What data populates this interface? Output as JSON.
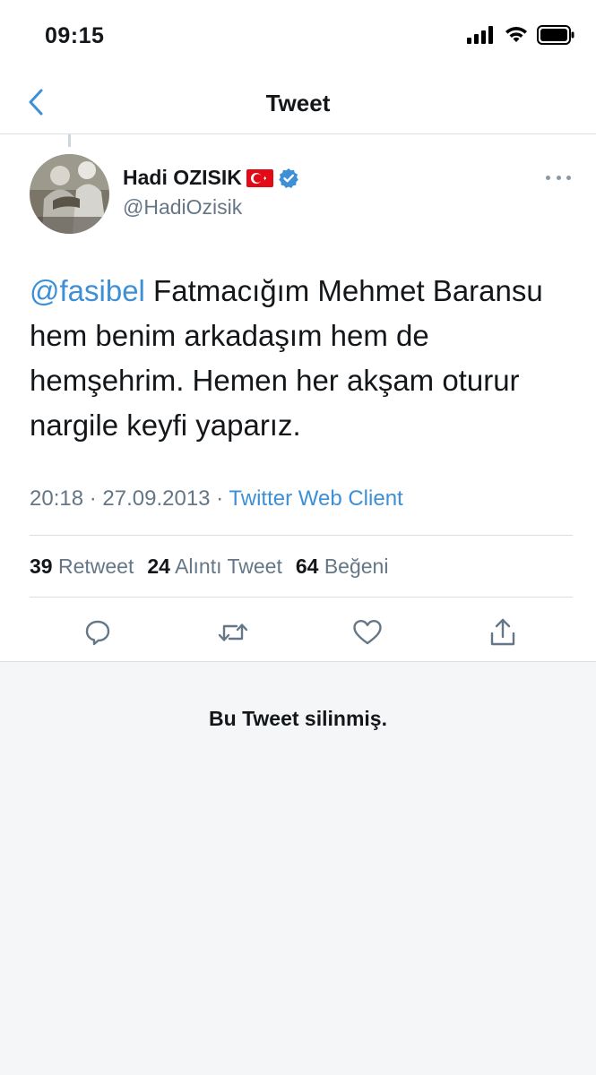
{
  "status_bar": {
    "time": "09:15"
  },
  "nav": {
    "title": "Tweet"
  },
  "tweet": {
    "author_name": "Hadi OZISIK",
    "author_handle": "@HadiOzisik",
    "mention": "@fasibel",
    "body": " Fatmacığım Mehmet Baransu hem benim arkadaşım hem de hemşehrim. Hemen her akşam oturur nargile keyfi yaparız.",
    "time": "20:18",
    "date": "27.09.2013",
    "separator": " · ",
    "source": "Twitter Web Client"
  },
  "stats": {
    "retweets_count": "39",
    "retweets_label": "Retweet",
    "quotes_count": "24",
    "quotes_label": "Alıntı Tweet",
    "likes_count": "64",
    "likes_label": "Beğeni"
  },
  "icons": {
    "back": "chevron-left-icon",
    "reply": "reply-icon",
    "retweet": "retweet-icon",
    "like": "heart-icon",
    "share": "share-icon",
    "verified": "verified-badge-icon",
    "flag": "turkey-flag-icon"
  },
  "colors": {
    "accent": "#3d8fd6",
    "muted": "#657786",
    "text": "#14171a",
    "deleted_bg": "#f5f6f8"
  },
  "deleted_notice": "Bu Tweet silinmiş."
}
